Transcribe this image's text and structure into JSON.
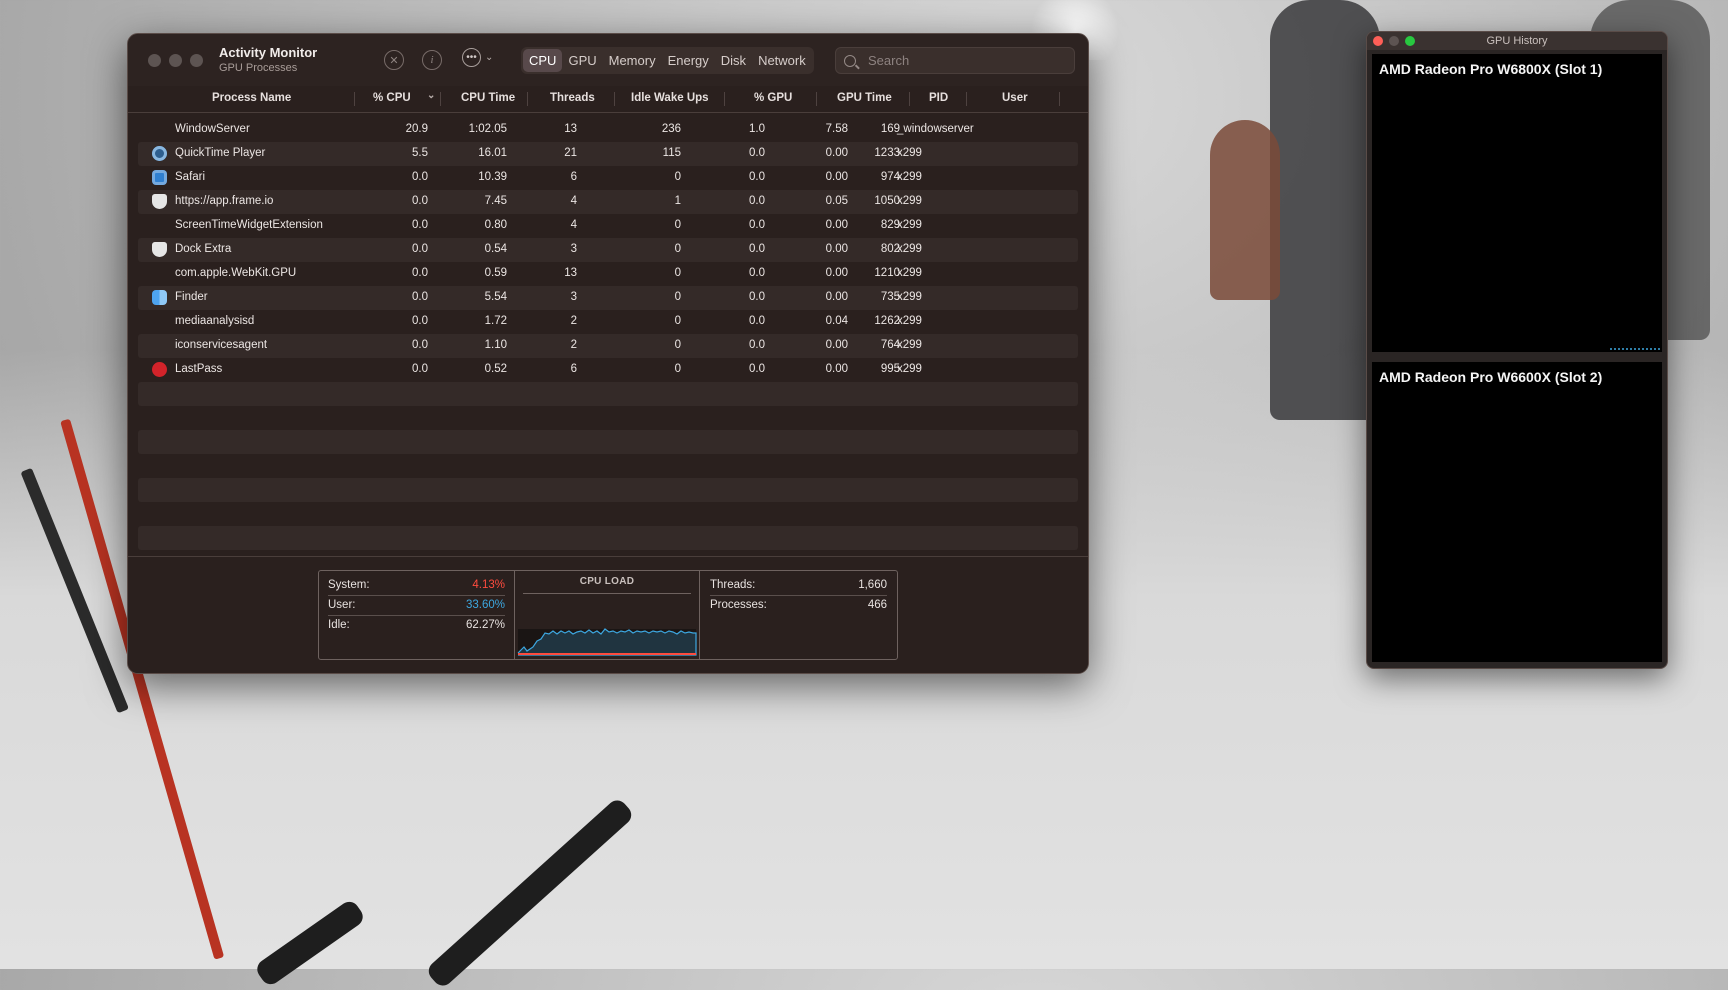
{
  "activity_monitor": {
    "title": "Activity Monitor",
    "subtitle": "GPU Processes",
    "toolbar": {
      "stop_icon": "x-circle-icon",
      "info_icon": "info-icon",
      "more_icon": "ellipsis-circle-icon"
    },
    "tabs": [
      {
        "label": "CPU",
        "active": true
      },
      {
        "label": "GPU",
        "active": false
      },
      {
        "label": "Memory",
        "active": false
      },
      {
        "label": "Energy",
        "active": false
      },
      {
        "label": "Disk",
        "active": false
      },
      {
        "label": "Network",
        "active": false
      }
    ],
    "search": {
      "placeholder": "Search"
    },
    "columns": [
      "Process Name",
      "% CPU",
      "CPU Time",
      "Threads",
      "Idle Wake Ups",
      "% GPU",
      "GPU Time",
      "PID",
      "User"
    ],
    "rows": [
      {
        "name": "WindowServer",
        "icon": "",
        "cpu": "20.9",
        "cpu_time": "1:02.05",
        "threads": "13",
        "idle": "236",
        "gpu": "1.0",
        "gpu_time": "7.58",
        "pid": "169",
        "user": "_windowserver"
      },
      {
        "name": "QuickTime Player",
        "icon": "quicktime-icon",
        "cpu": "5.5",
        "cpu_time": "16.01",
        "threads": "21",
        "idle": "115",
        "gpu": "0.0",
        "gpu_time": "0.00",
        "pid": "1233",
        "user": "x299"
      },
      {
        "name": "Safari",
        "icon": "safari-icon",
        "cpu": "0.0",
        "cpu_time": "10.39",
        "threads": "6",
        "idle": "0",
        "gpu": "0.0",
        "gpu_time": "0.00",
        "pid": "974",
        "user": "x299"
      },
      {
        "name": "https://app.frame.io",
        "icon": "shield-icon",
        "cpu": "0.0",
        "cpu_time": "7.45",
        "threads": "4",
        "idle": "1",
        "gpu": "0.0",
        "gpu_time": "0.05",
        "pid": "1050",
        "user": "x299"
      },
      {
        "name": "ScreenTimeWidgetExtension",
        "icon": "",
        "cpu": "0.0",
        "cpu_time": "0.80",
        "threads": "4",
        "idle": "0",
        "gpu": "0.0",
        "gpu_time": "0.00",
        "pid": "829",
        "user": "x299"
      },
      {
        "name": "Dock Extra",
        "icon": "shield-icon",
        "cpu": "0.0",
        "cpu_time": "0.54",
        "threads": "3",
        "idle": "0",
        "gpu": "0.0",
        "gpu_time": "0.00",
        "pid": "802",
        "user": "x299"
      },
      {
        "name": "com.apple.WebKit.GPU",
        "icon": "",
        "cpu": "0.0",
        "cpu_time": "0.59",
        "threads": "13",
        "idle": "0",
        "gpu": "0.0",
        "gpu_time": "0.00",
        "pid": "1210",
        "user": "x299"
      },
      {
        "name": "Finder",
        "icon": "finder-icon",
        "cpu": "0.0",
        "cpu_time": "5.54",
        "threads": "3",
        "idle": "0",
        "gpu": "0.0",
        "gpu_time": "0.00",
        "pid": "735",
        "user": "x299"
      },
      {
        "name": "mediaanalysisd",
        "icon": "",
        "cpu": "0.0",
        "cpu_time": "1.72",
        "threads": "2",
        "idle": "0",
        "gpu": "0.0",
        "gpu_time": "0.04",
        "pid": "1262",
        "user": "x299"
      },
      {
        "name": "iconservicesagent",
        "icon": "",
        "cpu": "0.0",
        "cpu_time": "1.10",
        "threads": "2",
        "idle": "0",
        "gpu": "0.0",
        "gpu_time": "0.00",
        "pid": "764",
        "user": "x299"
      },
      {
        "name": "LastPass",
        "icon": "lastpass-icon",
        "cpu": "0.0",
        "cpu_time": "0.52",
        "threads": "6",
        "idle": "0",
        "gpu": "0.0",
        "gpu_time": "0.00",
        "pid": "995",
        "user": "x299"
      }
    ],
    "stats": {
      "system_label": "System:",
      "system_value": "4.13%",
      "user_label": "User:",
      "user_value": "33.60%",
      "idle_label": "Idle:",
      "idle_value": "62.27%",
      "cpu_load_title": "CPU LOAD",
      "threads_label": "Threads:",
      "threads_value": "1,660",
      "processes_label": "Processes:",
      "processes_value": "466"
    },
    "colors": {
      "system": "#ff4b3e",
      "user": "#3da7e0"
    }
  },
  "gpu_history": {
    "title": "GPU History",
    "gpus": [
      {
        "label": "AMD Radeon Pro W6800X (Slot 1)"
      },
      {
        "label": "AMD Radeon Pro W6600X (Slot 2)"
      }
    ]
  }
}
